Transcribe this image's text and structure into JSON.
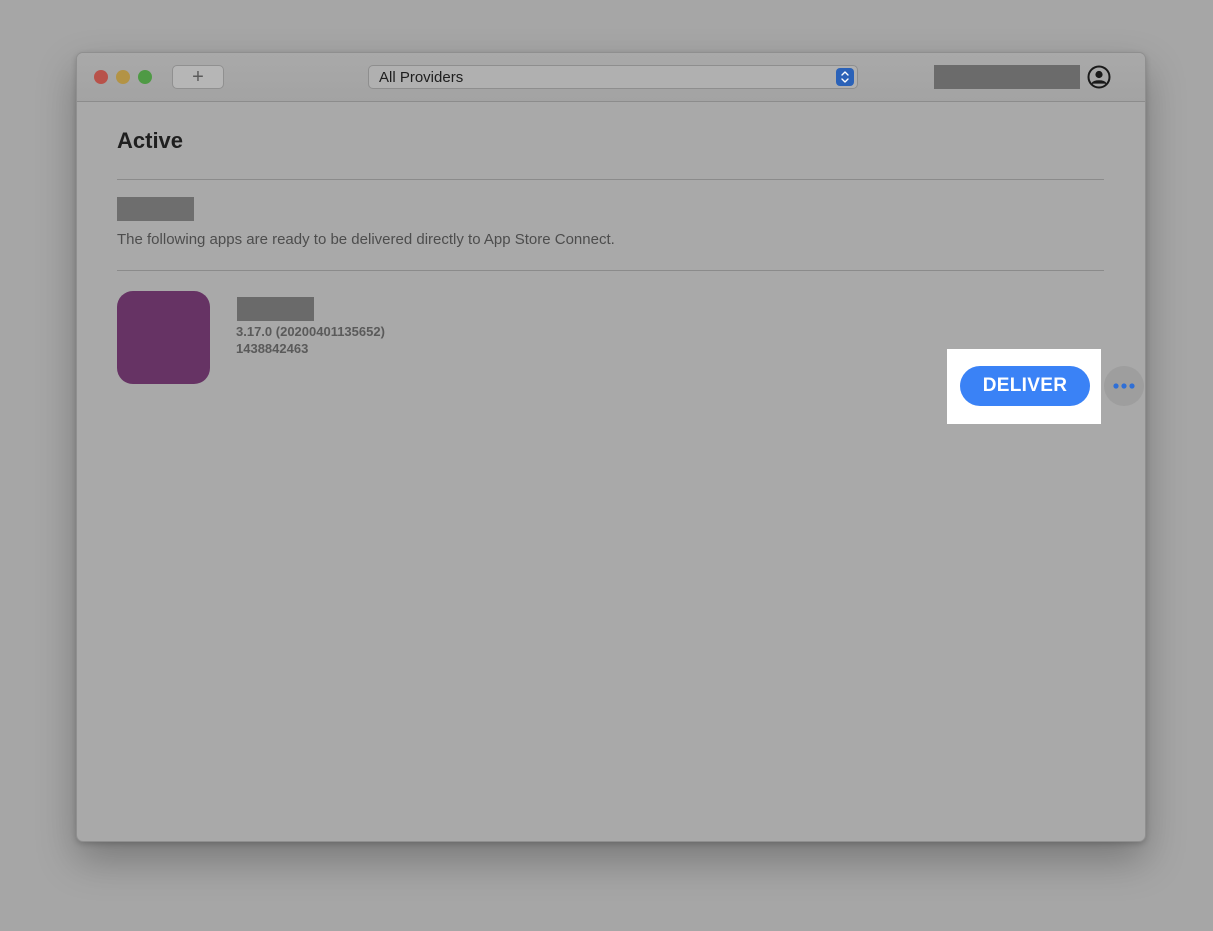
{
  "toolbar": {
    "add_label": "+",
    "provider_select": {
      "selected": "All Providers"
    },
    "account": {
      "icon": "account-icon"
    }
  },
  "main": {
    "title": "Active",
    "section": {
      "description": "The following apps are ready to be delivered directly to App Store Connect."
    },
    "apps": [
      {
        "version": "3.17.0 (20200401135652)",
        "app_id": "1438842463",
        "icon_color": "#663364",
        "deliver_label": "DELIVER",
        "more_icon": "ellipsis-icon"
      }
    ]
  },
  "colors": {
    "accent": "#3a82f6",
    "close": "#b8524a",
    "minimize": "#b39345",
    "maximize": "#4f9a45"
  }
}
